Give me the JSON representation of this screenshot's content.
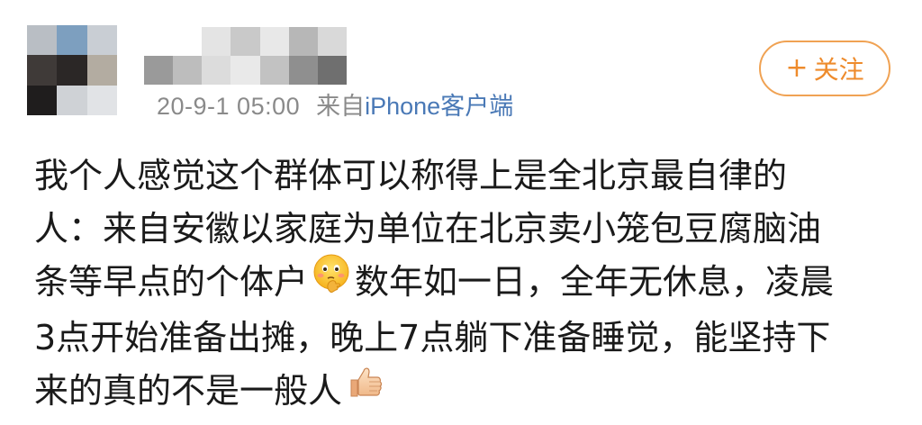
{
  "post": {
    "timestamp": "20-9-1 05:00",
    "from_label": "来自",
    "source": "iPhone客户端",
    "follow_button": {
      "plus": "+",
      "label": "关注"
    },
    "content_lines": [
      "我个人感觉这个群体可以称得上是全北京最自律的",
      "人：来自安徽以家庭为单位在北京卖小笼包豆腐脑油",
      "条等早点的个体户",
      "数年如一日，全年无休息，凌晨",
      "3点开始准备出摊，晚上7点躺下准备睡觉，能坚持下",
      "来的真的不是一般人"
    ],
    "emojis": {
      "thinking": "thinking-face-icon",
      "thumbs_up": "thumbs-up-icon"
    },
    "colors": {
      "accent_orange": "#ee8b2c",
      "link_blue": "#4a79b6",
      "meta_gray": "#8a8a8a",
      "text": "#1a1a1a"
    }
  }
}
